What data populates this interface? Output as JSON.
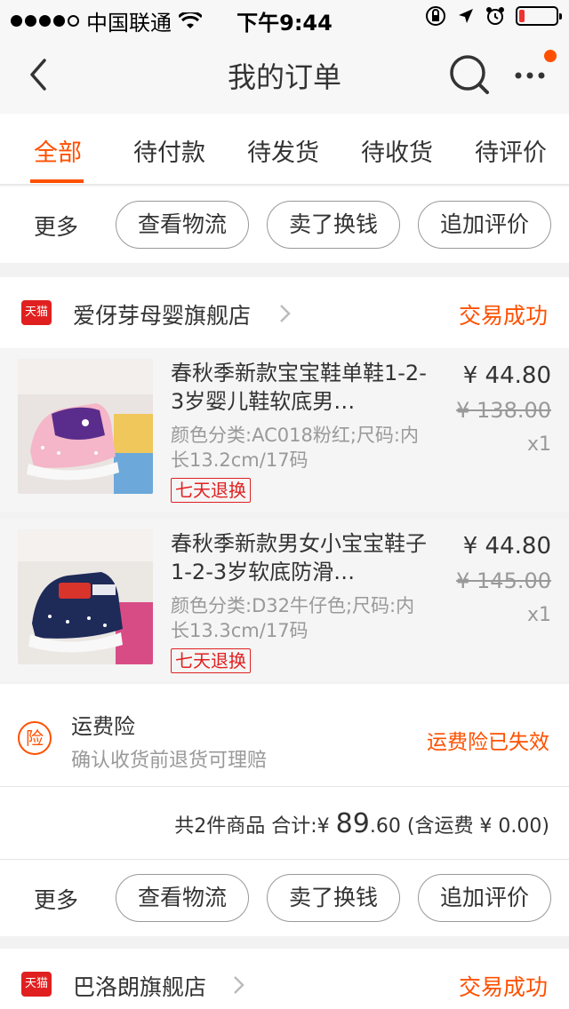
{
  "status_bar": {
    "carrier": "中国联通",
    "time": "下午9:44",
    "battery_level": 0.15
  },
  "nav": {
    "title": "我的订单",
    "icons": [
      "back-arrow-icon",
      "search-icon",
      "more-dots-icon"
    ]
  },
  "tabs": [
    {
      "label": "全部",
      "active": true
    },
    {
      "label": "待付款"
    },
    {
      "label": "待发货"
    },
    {
      "label": "待收货"
    },
    {
      "label": "待评价"
    }
  ],
  "actions": {
    "more": "更多",
    "logistics": "查看物流",
    "resell": "卖了换钱",
    "review": "追加评价"
  },
  "orders": [
    {
      "shop_badge": "天猫",
      "shop_name": "爱伢芽母婴旗舰店",
      "status": "交易成功",
      "items": [
        {
          "title": "春秋季新款宝宝鞋单鞋1-2-3岁婴儿鞋软底男…",
          "spec": "颜色分类:AC018粉红;尺码:内长13.2cm/17码",
          "badge": "七天退换",
          "price": "¥ 44.80",
          "original_price": "¥ 138.00",
          "qty": "x1"
        },
        {
          "title": "春秋季新款男女小宝宝鞋子1-2-3岁软底防滑…",
          "spec": "颜色分类:D32牛仔色;尺码:内长13.3cm/17码",
          "badge": "七天退换",
          "price": "¥ 44.80",
          "original_price": "¥ 145.00",
          "qty": "x1"
        }
      ],
      "insurance": {
        "icon_label": "险",
        "title": "运费险",
        "desc": "确认收货前退货可理赔",
        "status": "运费险已失效"
      },
      "summary": {
        "count": "共2件商品",
        "total_label": "合计:",
        "currency": "¥",
        "total_int": "89",
        "total_dec": ".60",
        "shipping": "(含运费 ¥ 0.00)"
      }
    },
    {
      "shop_badge": "天猫",
      "shop_name": "巴洛朗旗舰店",
      "status": "交易成功"
    }
  ],
  "colors": {
    "accent": "#ff5000",
    "tmall_red": "#e02020"
  }
}
